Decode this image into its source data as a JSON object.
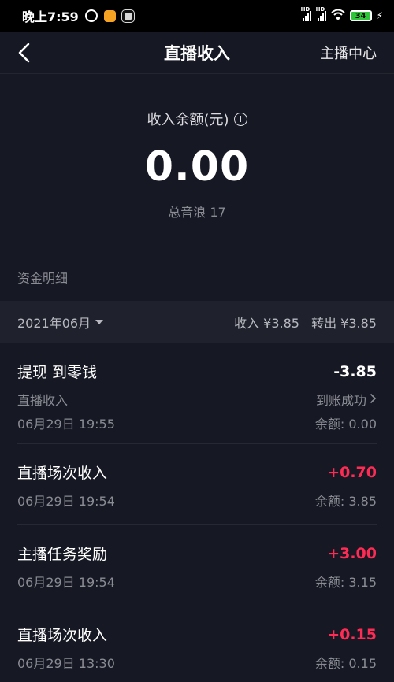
{
  "status_bar": {
    "time": "晚上7:59",
    "signal1_label": "HD",
    "signal2_label": "HD",
    "battery": "34",
    "icons": [
      "alarm-icon",
      "orange-app-icon",
      "gray-app-icon",
      "signal-icon",
      "wifi-icon",
      "battery-icon",
      "charging-icon"
    ]
  },
  "header": {
    "title": "直播收入",
    "right_link": "主播中心",
    "back_icon": "chevron-left-icon"
  },
  "balance": {
    "label": "收入余额(元)",
    "info_icon": "i",
    "amount": "0.00",
    "sub": "总音浪 17"
  },
  "details": {
    "section_title": "资金明细",
    "month": "2021年06月",
    "income": "收入 ¥3.85",
    "transfer": "转出 ¥3.85"
  },
  "transactions": [
    {
      "title": "提现 到零钱",
      "amount": "-3.85",
      "subtitle": "直播收入",
      "status": "到账成功",
      "time": "06月29日 19:55",
      "balance": "余额: 0.00"
    },
    {
      "title": "直播场次收入",
      "amount": "+0.70",
      "time": "06月29日 19:54",
      "balance": "余额: 3.85"
    },
    {
      "title": "主播任务奖励",
      "amount": "+3.00",
      "time": "06月29日 19:54",
      "balance": "余额: 3.15"
    },
    {
      "title": "直播场次收入",
      "amount": "+0.15",
      "time": "06月29日 13:30",
      "balance": "余额: 0.15"
    }
  ],
  "colors": {
    "background": "#161823",
    "positive": "#fe2c55",
    "muted": "#8a8b93"
  }
}
